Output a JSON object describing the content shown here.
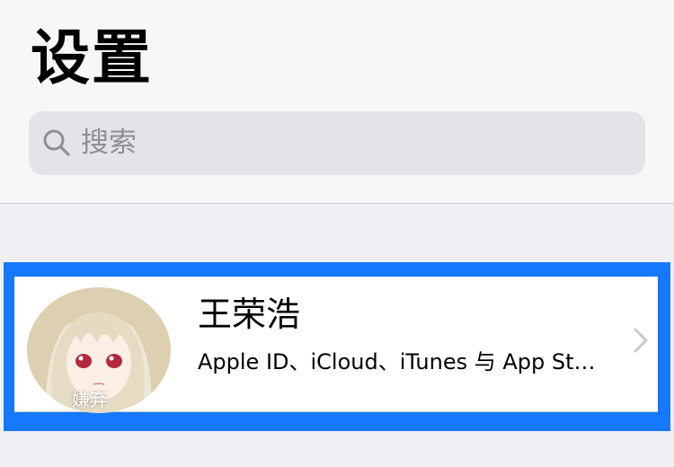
{
  "header": {
    "title": "设置"
  },
  "search": {
    "placeholder": "搜索",
    "icon": "search-icon"
  },
  "profile": {
    "name": "王荣浩",
    "subtitle": "Apple ID、iCloud、iTunes 与 App St…",
    "avatar_caption": "嫌弃",
    "chevron_icon": "chevron-right-icon"
  },
  "colors": {
    "highlight": "#1677ff",
    "background": "#efeff4",
    "search_field": "#e3e3e8",
    "placeholder": "#8e8e93"
  }
}
